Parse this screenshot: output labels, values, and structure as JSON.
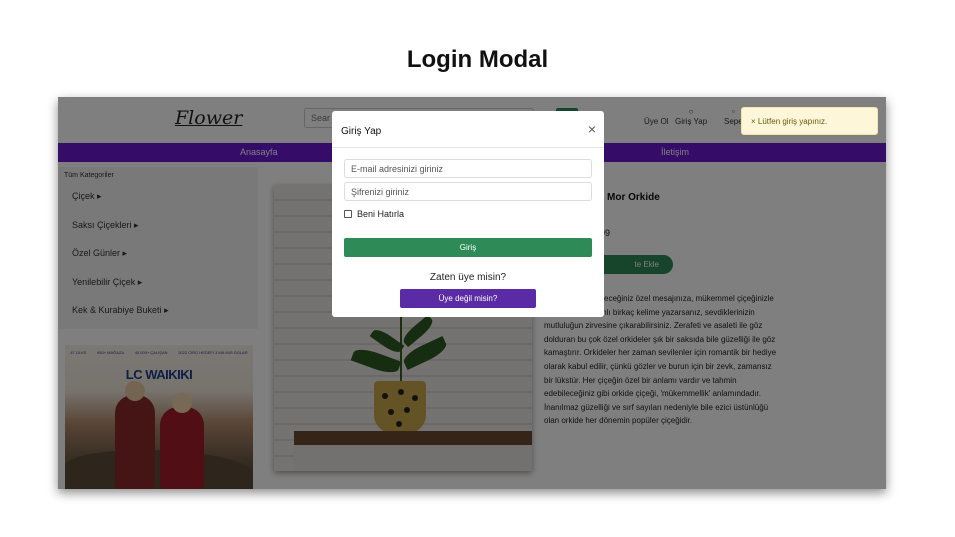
{
  "slide": {
    "title": "Login Modal"
  },
  "header": {
    "logo": "Flower",
    "search_placeholder": "Sear",
    "links": {
      "register": "Üye Ol",
      "login": "Giriş Yap",
      "cart": "Sepe"
    }
  },
  "nav": {
    "home": "Anasayfa",
    "contact": "İletişim"
  },
  "sidebar": {
    "title": "Tüm Kategoriler",
    "items": [
      "Çiçek",
      "Saksı Çiçekleri",
      "Özel Günler",
      "Yenilebilir Çiçek",
      "Kek & Kurabiye Buketi"
    ]
  },
  "ad": {
    "brand": "LC WAIKIKI",
    "stats": [
      "47 ÜLKE",
      "950+ MAĞAZA",
      "40.000+ ÇALIŞAN",
      "2022 CİRO HEDEFİ 3 MİLYAR DOLAR"
    ]
  },
  "product": {
    "title": "Mor Orkide",
    "price": "99",
    "add_to_cart": "te Ekle",
    "description_lines": [
      "yeceğiniz özel mesajınıza, mükemmel çiçeğinizle",
      "mlı birkaç kelime yazarsanız, sevdiklerinizin",
      "mutluluğun zirvesine çıkarabilirsiniz. Zerafeti ve asaleti ile göz",
      "dolduran bu çok özel orkideler şık bir saksıda bile güzelliği ile göz",
      "kamaştırır. Orkideler her zaman sevilenler için romantik bir hediye",
      "olarak kabul edilir, çünkü gözler ve burun için bir zevk, zamansız",
      "bir lükstür. Her çiçeğin özel bir anlamı vardır ve tahmin",
      "edebileceğiniz gibi orkide çiçeği, 'mükemmellik' anlamındadır.",
      "İnanılmaz güzelliği ve sırf sayıları nedeniyle bile ezici üstünlüğü",
      "olan orkide her dönemin popüler çiçeğidir."
    ]
  },
  "toast": {
    "message": "× Lütfen giriş yapınız."
  },
  "modal": {
    "title": "Giriş Yap",
    "close": "×",
    "email_placeholder": "E-mail adresinizi giriniz",
    "password_placeholder": "Şifrenizi giriniz",
    "remember_label": "Beni Hatırla",
    "login_button": "Giriş",
    "member_question": "Zaten üye misin?",
    "register_button": "Üye değil misin?"
  },
  "colors": {
    "accent": "#6a1bd3",
    "primary": "#2e8b57",
    "secondary": "#5b2ba5",
    "toast_bg": "#fdf6d8"
  }
}
